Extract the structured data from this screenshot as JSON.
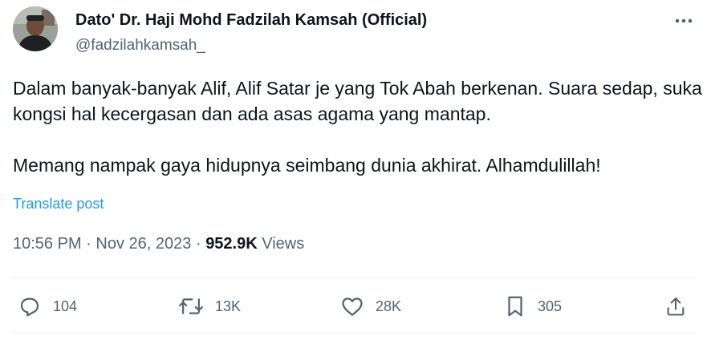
{
  "author": {
    "display_name": "Dato' Dr. Haji Mohd Fadzilah Kamsah (Official)",
    "handle": "@fadzilahkamsah_",
    "avatar_icon": "profile-photo"
  },
  "menu": {
    "icon": "more-horizontal-icon"
  },
  "post": {
    "paragraphs": [
      "Dalam banyak-banyak Alif, Alif Satar je yang Tok Abah berkenan. Suara sedap, suka kongsi hal kecergasan dan ada asas agama yang mantap.",
      "Memang nampak gaya hidupnya seimbang dunia akhirat. Alhamdulillah!"
    ],
    "translate_label": "Translate post",
    "time": "10:56 PM",
    "separator": "·",
    "date": "Nov 26, 2023",
    "views_count": "952.9K",
    "views_label": "Views"
  },
  "actions": {
    "reply": {
      "icon": "reply-icon",
      "count": "104"
    },
    "repost": {
      "icon": "repost-icon",
      "count": "13K"
    },
    "like": {
      "icon": "heart-icon",
      "count": "28K"
    },
    "bookmark": {
      "icon": "bookmark-icon",
      "count": "305"
    },
    "share": {
      "icon": "share-icon"
    }
  },
  "colors": {
    "text_primary": "#0f1419",
    "text_secondary": "#536471",
    "link": "#1d9bf0",
    "divider": "#eff3f4"
  }
}
